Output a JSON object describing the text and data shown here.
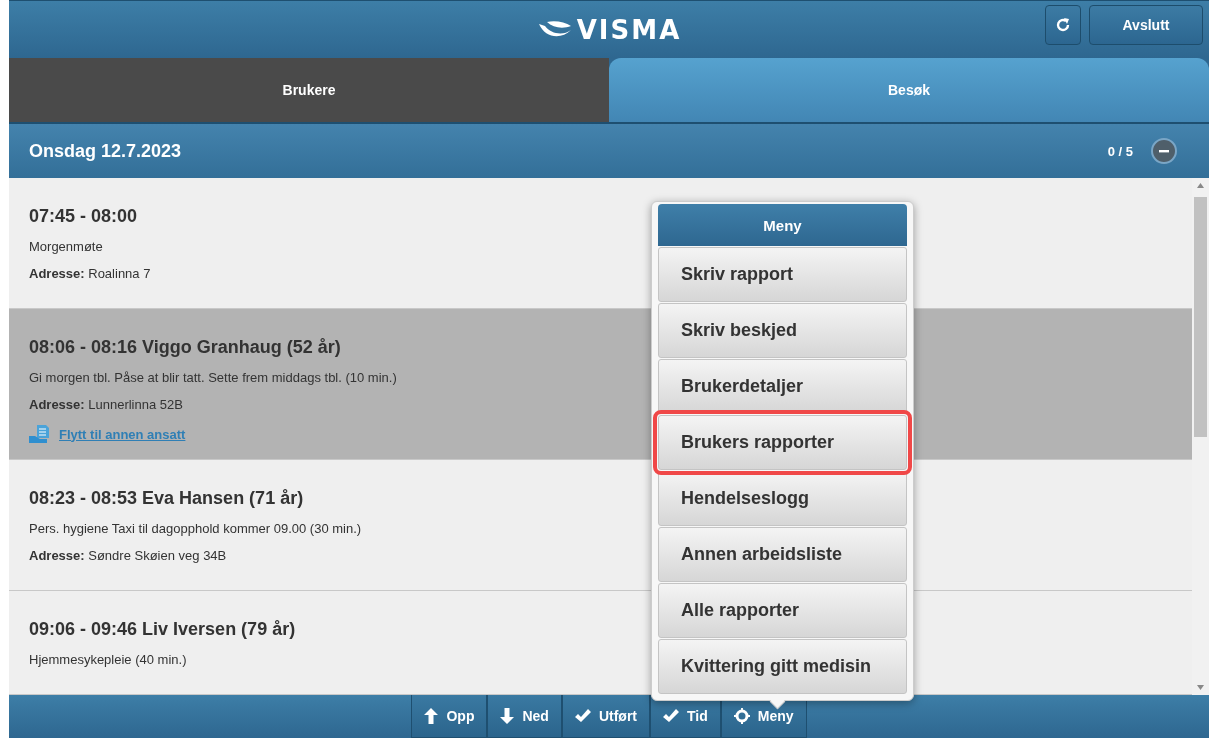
{
  "header": {
    "logo": "VISMA",
    "exit_button": "Avslutt"
  },
  "tabs": [
    {
      "label": "Brukere",
      "selected": false
    },
    {
      "label": "Besøk",
      "selected": true
    }
  ],
  "day": {
    "title": "Onsdag 12.7.2023",
    "count": "0 / 5",
    "expanded": true
  },
  "visits": [
    {
      "heading": "07:45 - 08:00",
      "description": "Morgenmøte",
      "address_label": "Adresse:",
      "address": "Roalinna 7",
      "selected": false
    },
    {
      "heading": "08:06 - 08:16 Viggo Granhaug (52 år)",
      "description": "Gi morgen tbl. Påse at blir tatt. Sette frem middags tbl. (10 min.)",
      "address_label": "Adresse:",
      "address": "Lunnerlinna 52B",
      "link": "Flytt til annen ansatt",
      "selected": true
    },
    {
      "heading": "08:23 - 08:53 Eva Hansen (71 år)",
      "description": "Pers. hygiene Taxi til dagopphold kommer 09.00 (30 min.)",
      "address_label": "Adresse:",
      "address": "Søndre Skøien veg 34B",
      "selected": false
    },
    {
      "heading": "09:06 - 09:46 Liv Iversen (79 år)",
      "description": "Hjemmesykepleie (40 min.)",
      "selected": false
    }
  ],
  "menu": {
    "title": "Meny",
    "items": [
      {
        "label": "Skriv rapport",
        "highlighted": false
      },
      {
        "label": "Skriv beskjed",
        "highlighted": false
      },
      {
        "label": "Brukerdetaljer",
        "highlighted": false
      },
      {
        "label": "Brukers rapporter",
        "highlighted": true
      },
      {
        "label": "Hendelseslogg",
        "highlighted": false
      },
      {
        "label": "Annen arbeidsliste",
        "highlighted": false
      },
      {
        "label": "Alle rapporter",
        "highlighted": false
      },
      {
        "label": "Kvittering gitt medisin",
        "highlighted": false
      }
    ]
  },
  "toolbar": [
    "Opp",
    "Ned",
    "Utført",
    "Tid",
    "Meny"
  ]
}
